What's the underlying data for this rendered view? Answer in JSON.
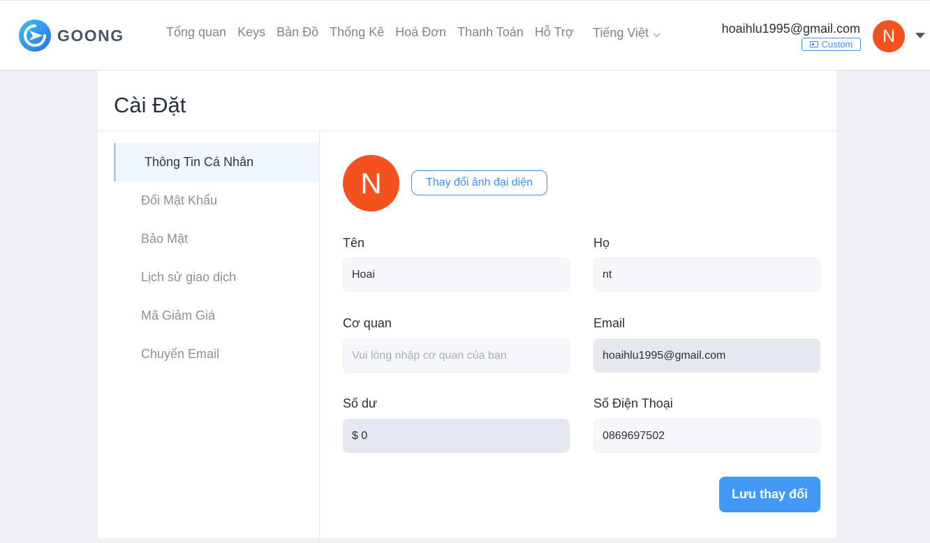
{
  "header": {
    "brand": "GOONG",
    "nav": [
      "Tổng quan",
      "Keys",
      "Bản Đồ",
      "Thống Kê",
      "Hoá Đơn",
      "Thanh Toán",
      "Hỗ Trợ"
    ],
    "language": "Tiếng Việt",
    "user_email": "hoaihlu1995@gmail.com",
    "plan": "Custom",
    "avatar_initial": "N"
  },
  "page": {
    "title": "Cài Đặt"
  },
  "sidebar": {
    "items": [
      {
        "label": "Thông Tin Cá Nhân",
        "active": true
      },
      {
        "label": "Đổi Mật Khẩu",
        "active": false
      },
      {
        "label": "Bảo Mật",
        "active": false
      },
      {
        "label": "Lịch sử giao dịch",
        "active": false
      },
      {
        "label": "Mã Giảm Giá",
        "active": false
      },
      {
        "label": "Chuyển Email",
        "active": false
      }
    ]
  },
  "profile": {
    "avatar_initial": "N",
    "change_avatar_label": "Thay đổi ảnh đại diện",
    "first_name": {
      "label": "Tên",
      "value": "Hoai"
    },
    "last_name": {
      "label": "Họ",
      "value": "nt"
    },
    "organization": {
      "label": "Cơ quan",
      "value": "",
      "placeholder": "Vui lòng nhập cơ quan của bạn"
    },
    "email": {
      "label": "Email",
      "value": "hoaihlu1995@gmail.com"
    },
    "balance": {
      "label": "Số dư",
      "value": "$ 0"
    },
    "phone": {
      "label": "Số Điện Thoại",
      "value": "0869697502"
    },
    "save_label": "Lưu thay đổi"
  },
  "colors": {
    "accent": "#3d8ef0",
    "avatar": "#f4511e",
    "save_button": "#4299f5",
    "background": "#eef0f6"
  }
}
